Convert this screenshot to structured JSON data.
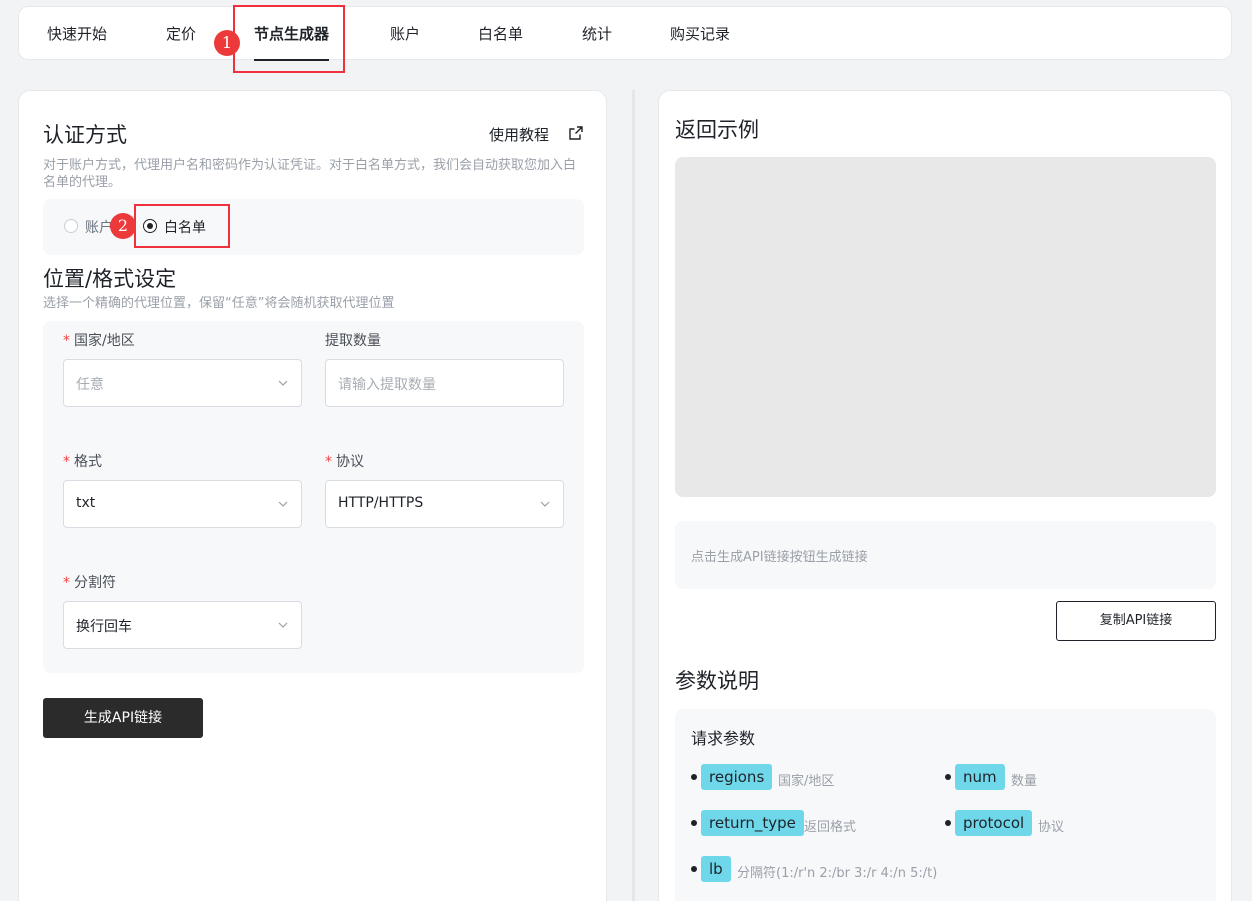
{
  "tabs": [
    {
      "label": "快速开始"
    },
    {
      "label": "定价"
    },
    {
      "label": "节点生成器"
    },
    {
      "label": "账户"
    },
    {
      "label": "白名单"
    },
    {
      "label": "统计"
    },
    {
      "label": "购买记录"
    }
  ],
  "active_tab": "节点生成器",
  "annotations": {
    "step1": "1",
    "step2": "2",
    "highlight_color": "#f0303c"
  },
  "auth": {
    "title": "认证方式",
    "tutorial_label": "使用教程",
    "description": "对于账户方式，代理用户名和密码作为认证凭证。对于白名单方式，我们会自动获取您加入白名单的代理。",
    "option_account": "账户",
    "option_whitelist": "白名单",
    "selected": "白名单"
  },
  "location": {
    "title": "位置/格式设定",
    "description": "选择一个精确的代理位置，保留“任意”将会随机获取代理位置",
    "country_label": "国家/地区",
    "country_value": "任意",
    "quantity_label": "提取数量",
    "quantity_placeholder": "请输入提取数量",
    "format_label": "格式",
    "format_value": "txt",
    "protocol_label": "协议",
    "protocol_value": "HTTP/HTTPS",
    "separator_label": "分割符",
    "separator_value": "换行回车",
    "required_mark": "*"
  },
  "generate_button": "生成API链接",
  "result": {
    "title": "返回示例",
    "link_placeholder": "点击生成API链接按钮生成链接",
    "copy_button": "复制API链接"
  },
  "params": {
    "title": "参数说明",
    "subtitle": "请求参数",
    "items": [
      {
        "name": "regions",
        "desc": "国家/地区"
      },
      {
        "name": "num",
        "desc": "数量"
      },
      {
        "name": "return_type",
        "desc": "返回格式"
      },
      {
        "name": "protocol",
        "desc": "协议"
      },
      {
        "name": "lb",
        "desc": "分隔符(1:/r'n 2:/br 3:/r 4:/n 5:/t)"
      }
    ]
  },
  "colors": {
    "accent_dark": "#2b2b2b",
    "tag_bg": "#6fd7ea",
    "required": "#f53f3f"
  }
}
